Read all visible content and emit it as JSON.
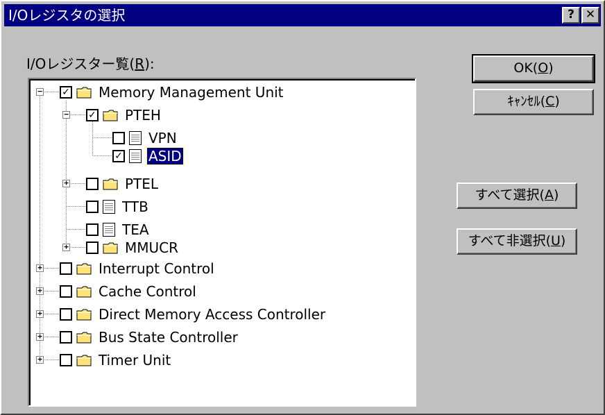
{
  "dialog": {
    "title": "I/Oレジスタの選択",
    "help_button": "?",
    "close_button": "✕"
  },
  "list": {
    "label_main": "I/Oレジスター覧(",
    "label_key": "R",
    "label_end": "):"
  },
  "tree": {
    "mmu": {
      "label": "Memory Management Unit",
      "checked": true,
      "expanded": true
    },
    "pteh": {
      "label": "PTEH",
      "checked": true,
      "expanded": true
    },
    "vpn": {
      "label": "VPN",
      "checked": false
    },
    "asid": {
      "label": "ASID",
      "checked": true,
      "selected": true
    },
    "ptel": {
      "label": "PTEL",
      "checked": false
    },
    "ttb": {
      "label": "TTB",
      "checked": false
    },
    "tea": {
      "label": "TEA",
      "checked": false
    },
    "mmucr": {
      "label": "MMUCR",
      "checked": false
    },
    "interrupt": {
      "label": "Interrupt Control",
      "checked": false
    },
    "cache": {
      "label": "Cache Control",
      "checked": false
    },
    "dmac": {
      "label": "Direct Memory Access Controller",
      "checked": false
    },
    "bsc": {
      "label": "Bus State Controller",
      "checked": false
    },
    "timer": {
      "label": "Timer Unit",
      "checked": false
    }
  },
  "buttons": {
    "ok_main": "OK(",
    "ok_key": "O",
    "ok_end": ")",
    "cancel_main": "ｷｬﾝｾﾙ(",
    "cancel_key": "C",
    "cancel_end": ")",
    "select_all_main": "すべて選択(",
    "select_all_key": "A",
    "select_all_end": ")",
    "deselect_all_main": "すべて非選択(",
    "deselect_all_key": "U",
    "deselect_all_end": ")"
  },
  "glyphs": {
    "check": "✓",
    "plus": "+",
    "minus": "−"
  }
}
